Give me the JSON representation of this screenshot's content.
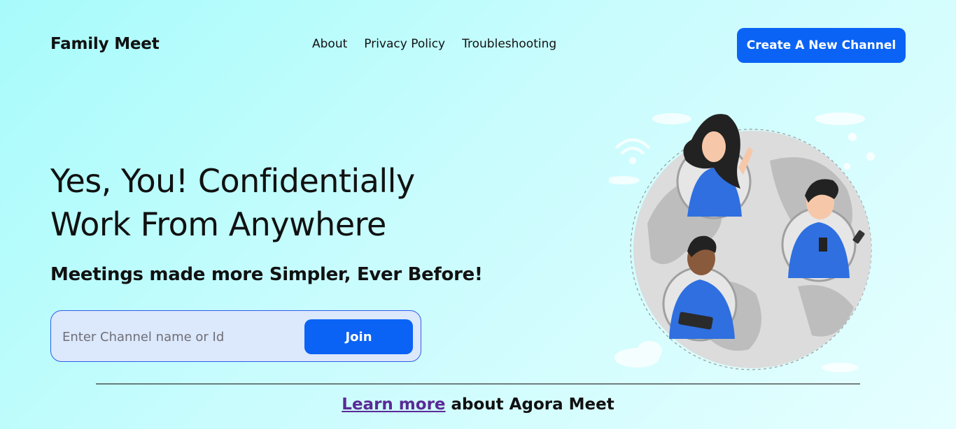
{
  "header": {
    "brand": "Family Meet",
    "nav": [
      "About",
      "Privacy Policy",
      "Troubleshooting"
    ],
    "cta_label": "Create A New Channel"
  },
  "hero": {
    "headline_line1": "Yes, You! Confidentially",
    "headline_line2": "Work From Anywhere",
    "subheadline": "Meetings made more Simpler, Ever Before!",
    "channel_input": {
      "placeholder": "Enter Channel name or Id",
      "value": ""
    },
    "join_label": "Join"
  },
  "footer": {
    "link_text": "Learn more",
    "rest_text": " about Agora Meet"
  },
  "colors": {
    "accent": "#0a63f5",
    "link": "#5a2a96",
    "background_start": "#a8fbfb",
    "background_end": "#e6feff"
  }
}
